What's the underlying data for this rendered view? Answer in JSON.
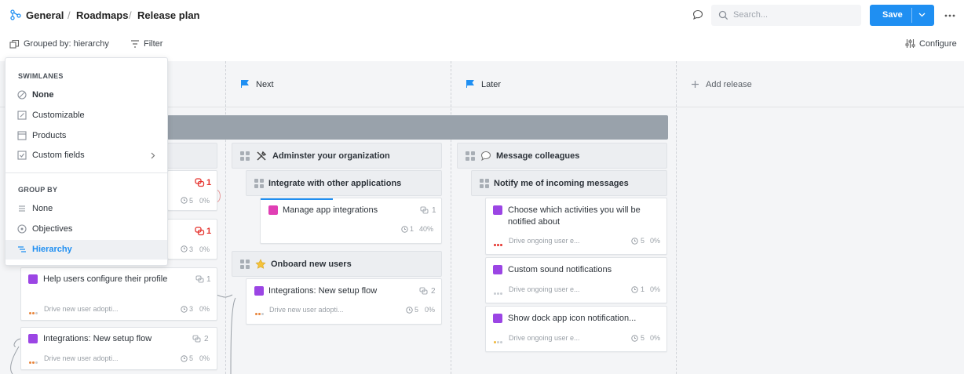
{
  "breadcrumb": {
    "root": "General",
    "section": "Roadmaps",
    "page": "Release plan",
    "separator": "/"
  },
  "search": {
    "placeholder": "Search..."
  },
  "actions": {
    "save_label": "Save"
  },
  "toolbar": {
    "grouped_by": "Grouped by: hierarchy",
    "filter": "Filter",
    "configure": "Configure"
  },
  "columns": {
    "next": "Next",
    "later": "Later",
    "add_release": "Add release"
  },
  "menu": {
    "swimlanes_header": "SWIMLANES",
    "swimlanes": [
      "None",
      "Customizable",
      "Products",
      "Custom fields"
    ],
    "groupby_header": "GROUP BY",
    "groupby": [
      "None",
      "Objectives",
      "Hierarchy"
    ],
    "selected_groupby": "Hierarchy"
  },
  "left_cards": [
    {
      "comments": "1",
      "time": "5",
      "progress": "0%"
    },
    {
      "comments": "1",
      "time": "3",
      "progress": "0%"
    },
    {
      "title": "Help users configure their profile",
      "comments": "1",
      "objective": "Drive new user adopti...",
      "time": "3",
      "progress": "0%"
    },
    {
      "title": "Integrations: New setup flow",
      "comments": "2",
      "objective": "Drive new user adopti...",
      "time": "5",
      "progress": "0%"
    }
  ],
  "next_column": {
    "feature1": "Adminster your organization",
    "sub1": "Integrate with other applications",
    "card1": {
      "title": "Manage app integrations",
      "comments": "1",
      "time": "1",
      "progress": "40%"
    },
    "feature2": "Onboard new users",
    "card2": {
      "title": "Integrations: New setup flow",
      "comments": "2",
      "objective": "Drive new user adopti...",
      "time": "5",
      "progress": "0%"
    }
  },
  "later_column": {
    "feature1": "Message colleagues",
    "sub1": "Notify me of incoming messages",
    "cards": [
      {
        "title": "Choose which activities you will be notified about",
        "objective": "Drive ongoing user e...",
        "time": "5",
        "progress": "0%"
      },
      {
        "title": "Custom sound notifications",
        "objective": "Drive ongoing user e...",
        "time": "1",
        "progress": "0%"
      },
      {
        "title": "Show dock app icon notification...",
        "objective": "Drive ongoing user e...",
        "time": "5",
        "progress": "0%"
      }
    ]
  },
  "colors": {
    "accent": "#1f8ff2",
    "purple": "#9b45e4",
    "magenta": "#e03fb4",
    "alert_red": "#e5342f",
    "band": "#99a2ab"
  }
}
